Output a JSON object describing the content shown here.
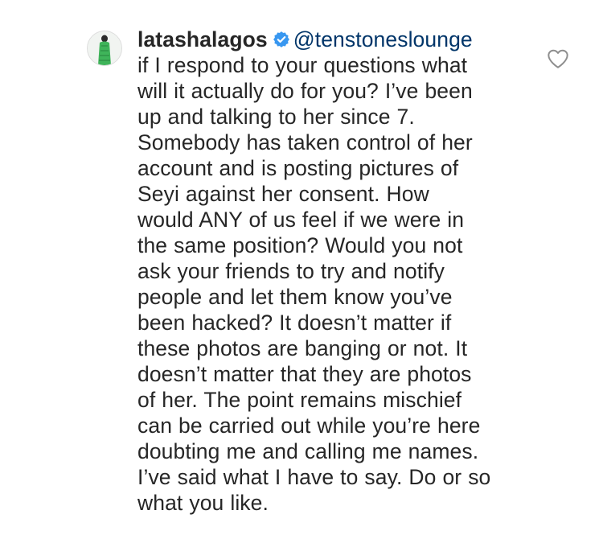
{
  "comment": {
    "username": "latashalagos",
    "mention": "@tenstoneslounge",
    "lines": [
      "if I respond to your questions what",
      "will it actually do for you? I’ve been",
      "up and talking to her since 7.",
      "Somebody has taken control of her",
      "account and is posting pictures of",
      "Seyi against her consent. How",
      "would ANY of us feel if we were in",
      "the same position? Would you not",
      "ask your friends to try and notify",
      "people and let them know you’ve",
      "been hacked? It doesn’t matter if",
      "these photos are banging or not. It",
      "doesn’t matter that they are photos",
      "of her. The point remains mischief",
      "can be carried out while you’re here",
      "doubting me and calling me names.",
      "I’ve said what I have to say. Do or so",
      "what you like."
    ]
  },
  "icons": {
    "avatar": "profile-photo",
    "verified": "verified-badge-icon",
    "like": "heart-outline-icon"
  },
  "colors": {
    "text": "#262626",
    "mention": "#003569",
    "verified_badge": "#3897f0",
    "heart_outline": "#8e8e8e",
    "background": "#ffffff"
  }
}
